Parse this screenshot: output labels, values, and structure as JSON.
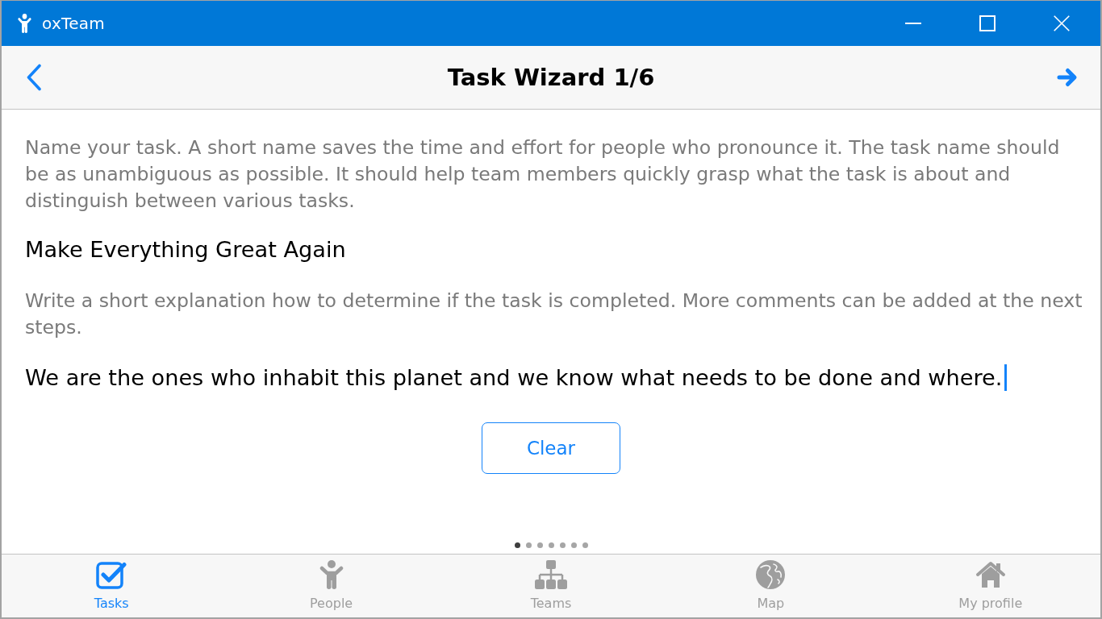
{
  "window": {
    "title": "oxTeam"
  },
  "header": {
    "title": "Task Wizard 1/6"
  },
  "wizard": {
    "fields": [
      {
        "hint": "Name your task. A short name saves the time and effort for people who pronounce it. The task name should be as unambiguous as possible. It should help team members quickly grasp what the task is about and distinguish between various tasks.",
        "value": "Make Everything Great Again",
        "focused": false
      },
      {
        "hint": "Write a short explanation how to determine if the task is completed. More comments can be added at the next steps.",
        "value": "We are the ones who inhabit this planet and we know what needs to be done and where.",
        "focused": true
      }
    ],
    "clear_button": "Clear"
  },
  "pager": [
    {
      "selected": true
    },
    {
      "selected": false
    },
    {
      "selected": false
    },
    {
      "selected": false
    },
    {
      "selected": false
    },
    {
      "selected": false
    },
    {
      "selected": false
    }
  ],
  "tabs": [
    {
      "kind": "tasks",
      "label": "Tasks",
      "selected": true
    },
    {
      "kind": "people",
      "label": "People",
      "selected": false
    },
    {
      "kind": "teams",
      "label": "Teams",
      "selected": false
    },
    {
      "kind": "map",
      "label": "Map",
      "selected": false
    },
    {
      "kind": "profile",
      "label": "My profile",
      "selected": false
    }
  ]
}
